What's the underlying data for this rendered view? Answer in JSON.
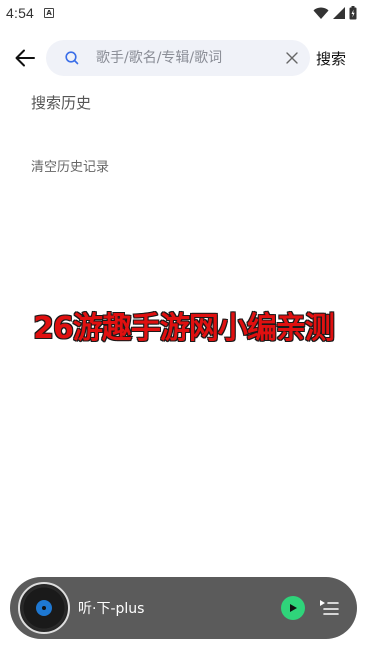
{
  "status_bar": {
    "time": "4:54",
    "icons": [
      "notification-a-icon",
      "wifi-icon",
      "cellular-signal-icon",
      "battery-icon"
    ]
  },
  "header": {
    "back_icon": "arrow-left-icon",
    "search_placeholder": "歌手/歌名/专辑/歌词",
    "search_value": "",
    "search_button_label": "搜索"
  },
  "history": {
    "title": "搜索历史",
    "clear_label": "清空历史记录"
  },
  "watermark": {
    "text": "26游趣手游网小编亲测"
  },
  "mini_player": {
    "title": "听·下-plus",
    "play_icon": "play-icon",
    "playlist_icon": "playlist-icon"
  },
  "colors": {
    "accent_green": "#2fd47a",
    "search_bg": "#f0f2f8",
    "player_bg": "#5b5b5b",
    "watermark_red": "#e01010"
  }
}
